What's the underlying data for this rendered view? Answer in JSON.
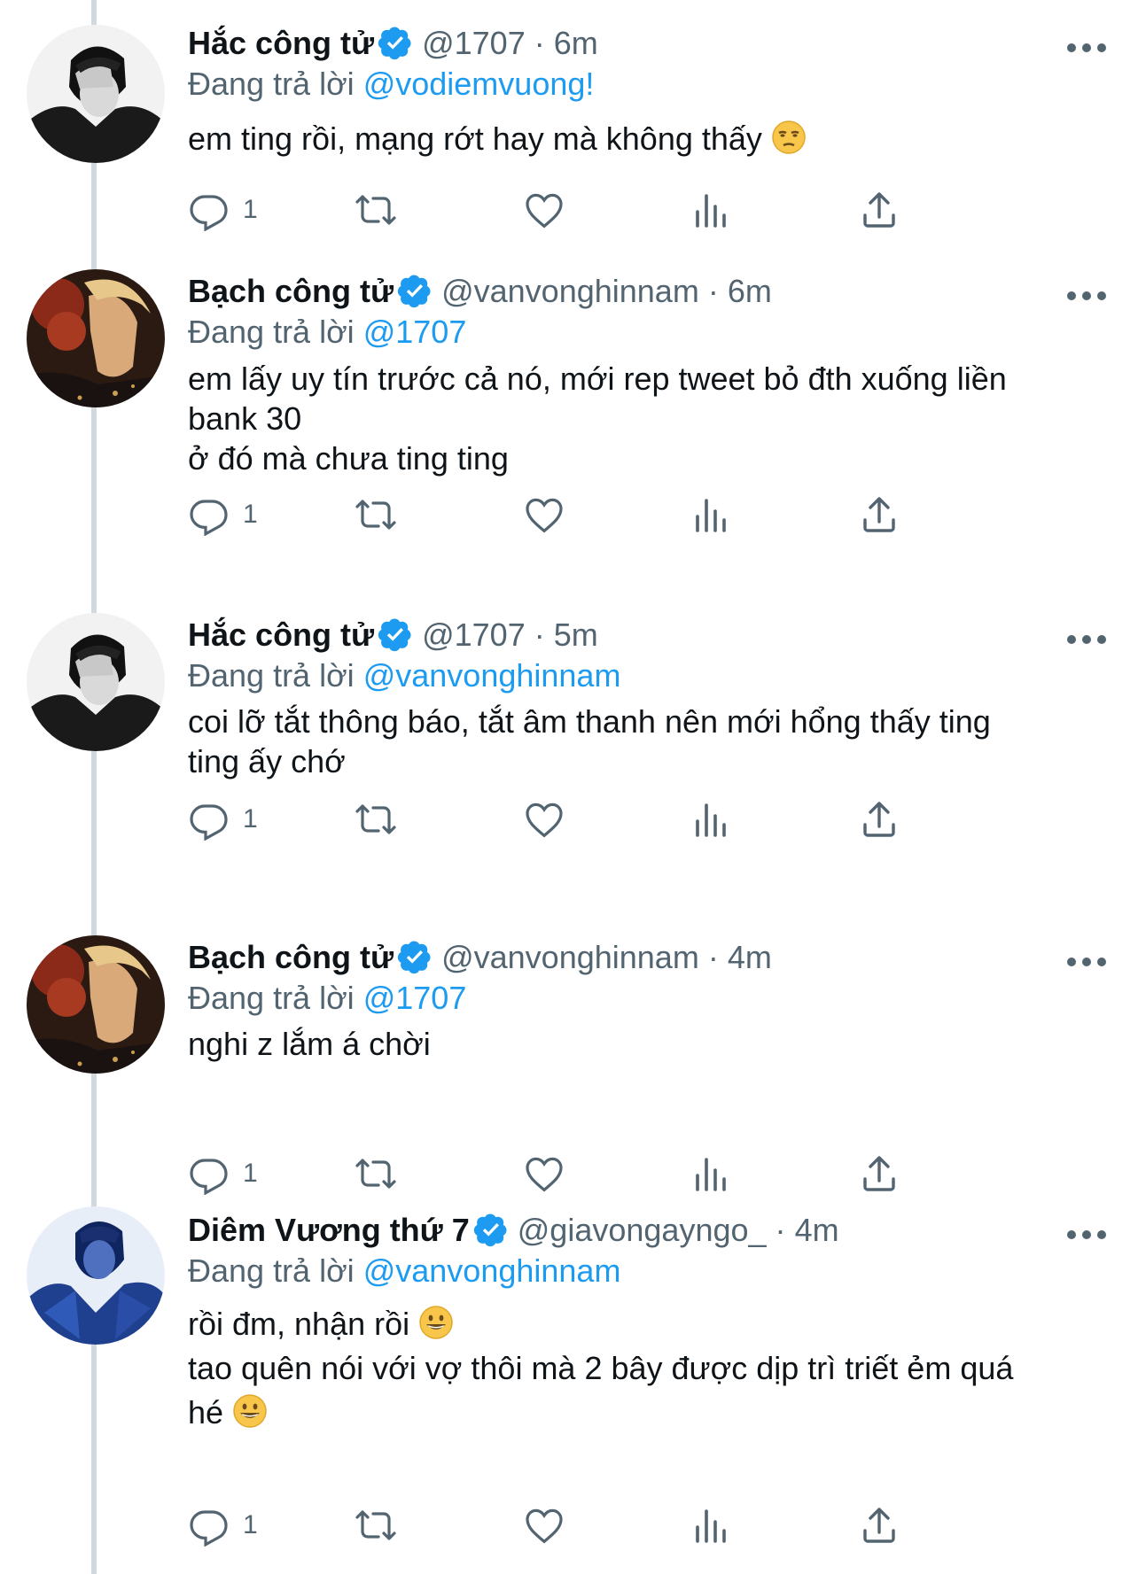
{
  "reply_prefix": "Đang trả lời",
  "colors": {
    "accent": "#1d9bf0",
    "secondary_text": "#536471",
    "thread_line": "#cfd9de"
  },
  "tweets": [
    {
      "name": "Hắc công tử",
      "handle": "@1707",
      "dot": "·",
      "time": "6m",
      "reply_to": "@vodiemvuong!",
      "lines": [
        "em ting rồi, mạng rớt hay mà không thấy"
      ],
      "reply_count": "1",
      "avatar": "hac-cong-tu-avatar"
    },
    {
      "name": "Bạch công tử",
      "handle": "@vanvonghinnam",
      "dot": "·",
      "time": "6m",
      "reply_to": "@1707",
      "lines": [
        "em lấy uy tín trước cả nó, mới rep tweet bỏ đth xuống liền",
        "bank 30",
        "ở đó mà chưa ting ting"
      ],
      "reply_count": "1",
      "avatar": "bach-cong-tu-avatar"
    },
    {
      "name": "Hắc công tử",
      "handle": "@1707",
      "dot": "·",
      "time": "5m",
      "reply_to": "@vanvonghinnam",
      "lines": [
        "coi lỡ tắt thông báo, tắt âm thanh nên mới hổng thấy ting",
        "ting ấy chớ"
      ],
      "reply_count": "1",
      "avatar": "hac-cong-tu-avatar"
    },
    {
      "name": "Bạch công tử",
      "handle": "@vanvonghinnam",
      "dot": "·",
      "time": "4m",
      "reply_to": "@1707",
      "lines": [
        "nghi z lắm á chời"
      ],
      "reply_count": "1",
      "avatar": "bach-cong-tu-avatar"
    },
    {
      "name": "Diêm Vương thứ 7",
      "handle": "@giavongayngo_",
      "dot": "·",
      "time": "4m",
      "reply_to": "@vanvonghinnam",
      "lines": [
        "rồi đm, nhận rồi",
        "tao quên nói với vợ thôi mà 2 bây được dịp trì triết ẻm quá",
        "hé"
      ],
      "reply_count": "1",
      "avatar": "diem-vuong-avatar"
    }
  ]
}
